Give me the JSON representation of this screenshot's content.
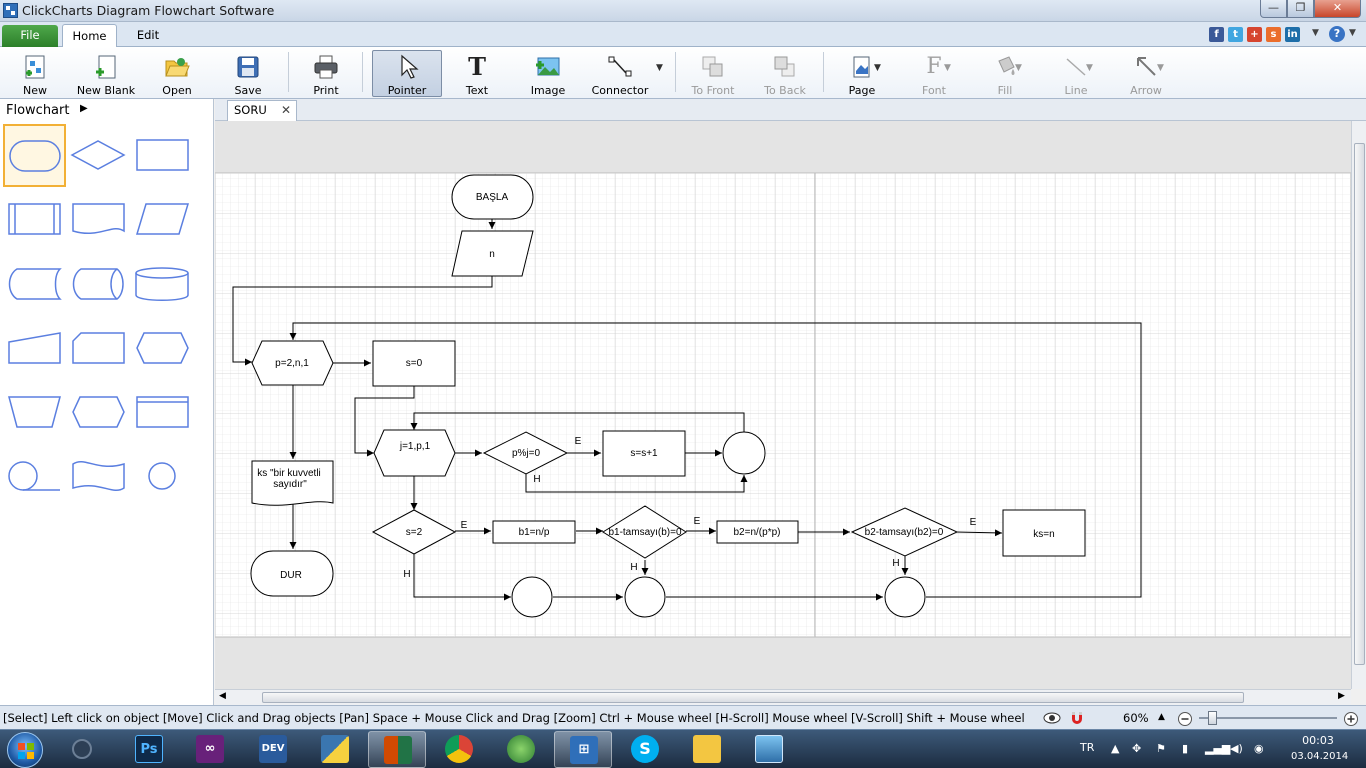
{
  "window": {
    "title": "ClickCharts Diagram Flowchart Software",
    "min": "—",
    "max": "❐",
    "close": "✕"
  },
  "ribbon": {
    "tabs": [
      {
        "label": "File"
      },
      {
        "label": "Home"
      },
      {
        "label": "Edit"
      }
    ]
  },
  "toolbar": {
    "new": "New",
    "new_blank": "New Blank",
    "open": "Open",
    "save": "Save",
    "print": "Print",
    "pointer": "Pointer",
    "text": "Text",
    "image": "Image",
    "connector": "Connector",
    "to_front": "To Front",
    "to_back": "To Back",
    "page": "Page",
    "font": "Font",
    "fill": "Fill",
    "line": "Line",
    "arrow": "Arrow"
  },
  "shapes_panel": {
    "title": "Flowchart"
  },
  "document": {
    "tab_label": "SORU"
  },
  "diagram": {
    "basla": "BAŞLA",
    "n": "n",
    "loop_p": "p=2,n,1",
    "s0": "s=0",
    "loop_j": "j=1,p,1",
    "cond_mod": "p%j=0",
    "inc_s": "s=s+1",
    "output_doc_line1": "ks \"bir kuvvetli",
    "output_doc_line2": "sayıdır\"",
    "dur": "DUR",
    "cond_s2": "s=2",
    "b1": "b1=n/p",
    "cond_b1": "b1-tamsayı(b)=0",
    "b2": "b2=n/(p*p)",
    "cond_b2": "b2-tamsayı(b2)=0",
    "ks": "ks=n",
    "yes": "E",
    "no": "H"
  },
  "status": {
    "text": "[Select] Left click on object  [Move] Click and Drag objects  [Pan] Space + Mouse Click and Drag  [Zoom] Ctrl + Mouse wheel  [H-Scroll] Mouse wheel  [V-Scroll] Shift + Mouse wheel",
    "zoom": "60%"
  },
  "taskbar": {
    "lang": "TR",
    "time": "00:03",
    "date": "03.04.2014",
    "ps": "Ps",
    "dev": "DEV"
  },
  "colors": {
    "accent": "#2f6fb9",
    "shape_stroke": "#5b7fe0",
    "file_tab": "#2c7f2a"
  }
}
